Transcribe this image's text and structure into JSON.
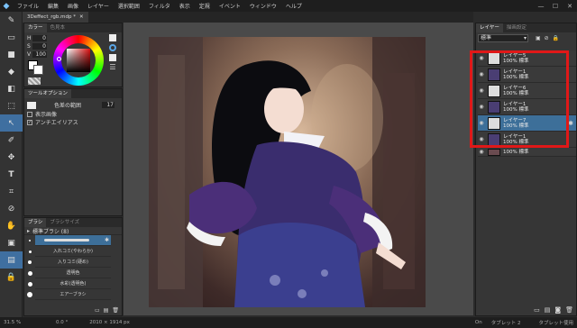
{
  "menu": {
    "items": [
      "ファイル",
      "編集",
      "画像",
      "レイヤー",
      "選択範囲",
      "フィルタ",
      "表示",
      "定規",
      "イベント",
      "ウィンドウ",
      "ヘルプ"
    ]
  },
  "document": {
    "tab_label": "3Deffect_rgb.mdp *"
  },
  "color_panel": {
    "tabs": [
      "カラー",
      "色見本"
    ],
    "h_label": "H",
    "h_value": "0",
    "s_label": "S",
    "s_value": "0",
    "v_label": "V",
    "v_value": "100"
  },
  "tool_options": {
    "title": "ツールオプション",
    "select_mode_label": "色差の範囲",
    "select_mode_value": "17",
    "show_image_label": "表示画像",
    "antialias_label": "アンチエイリアス"
  },
  "brush_panel": {
    "tabs": [
      "ブラシ",
      "ブラシサイズ"
    ],
    "group_label": "標準ブラシ (8)",
    "brushes": [
      "",
      "入れコミ(やわらか)",
      "入りコミ(硬め)",
      "透明色",
      "水彩(透明色)",
      "エアーブラシ"
    ]
  },
  "layer_panel": {
    "tabs": [
      "レイヤー",
      "描画設定"
    ],
    "blend_mode": "標準",
    "layers": [
      {
        "name": "レイヤー5",
        "props": "100% 標準",
        "selected": false
      },
      {
        "name": "レイヤー1",
        "props": "100% 標準",
        "selected": false
      },
      {
        "name": "レイヤー6",
        "props": "100% 標準",
        "selected": false
      },
      {
        "name": "レイヤー1",
        "props": "100% 標準",
        "selected": false
      },
      {
        "name": "レイヤー7",
        "props": "100% 標準",
        "selected": true
      },
      {
        "name": "レイヤー1",
        "props": "100% 標準",
        "selected": false
      },
      {
        "name": "",
        "props": "100% 標準",
        "selected": false
      }
    ]
  },
  "status": {
    "zoom": "31.5 %",
    "angle": "0.0 °",
    "size": "2010 × 1914 px",
    "on": "On",
    "tablet": "タブレット 2",
    "tablet_info": "タブレット使用"
  },
  "colors": {
    "accent": "#3d6f99",
    "highlight_box": "#e01818"
  }
}
